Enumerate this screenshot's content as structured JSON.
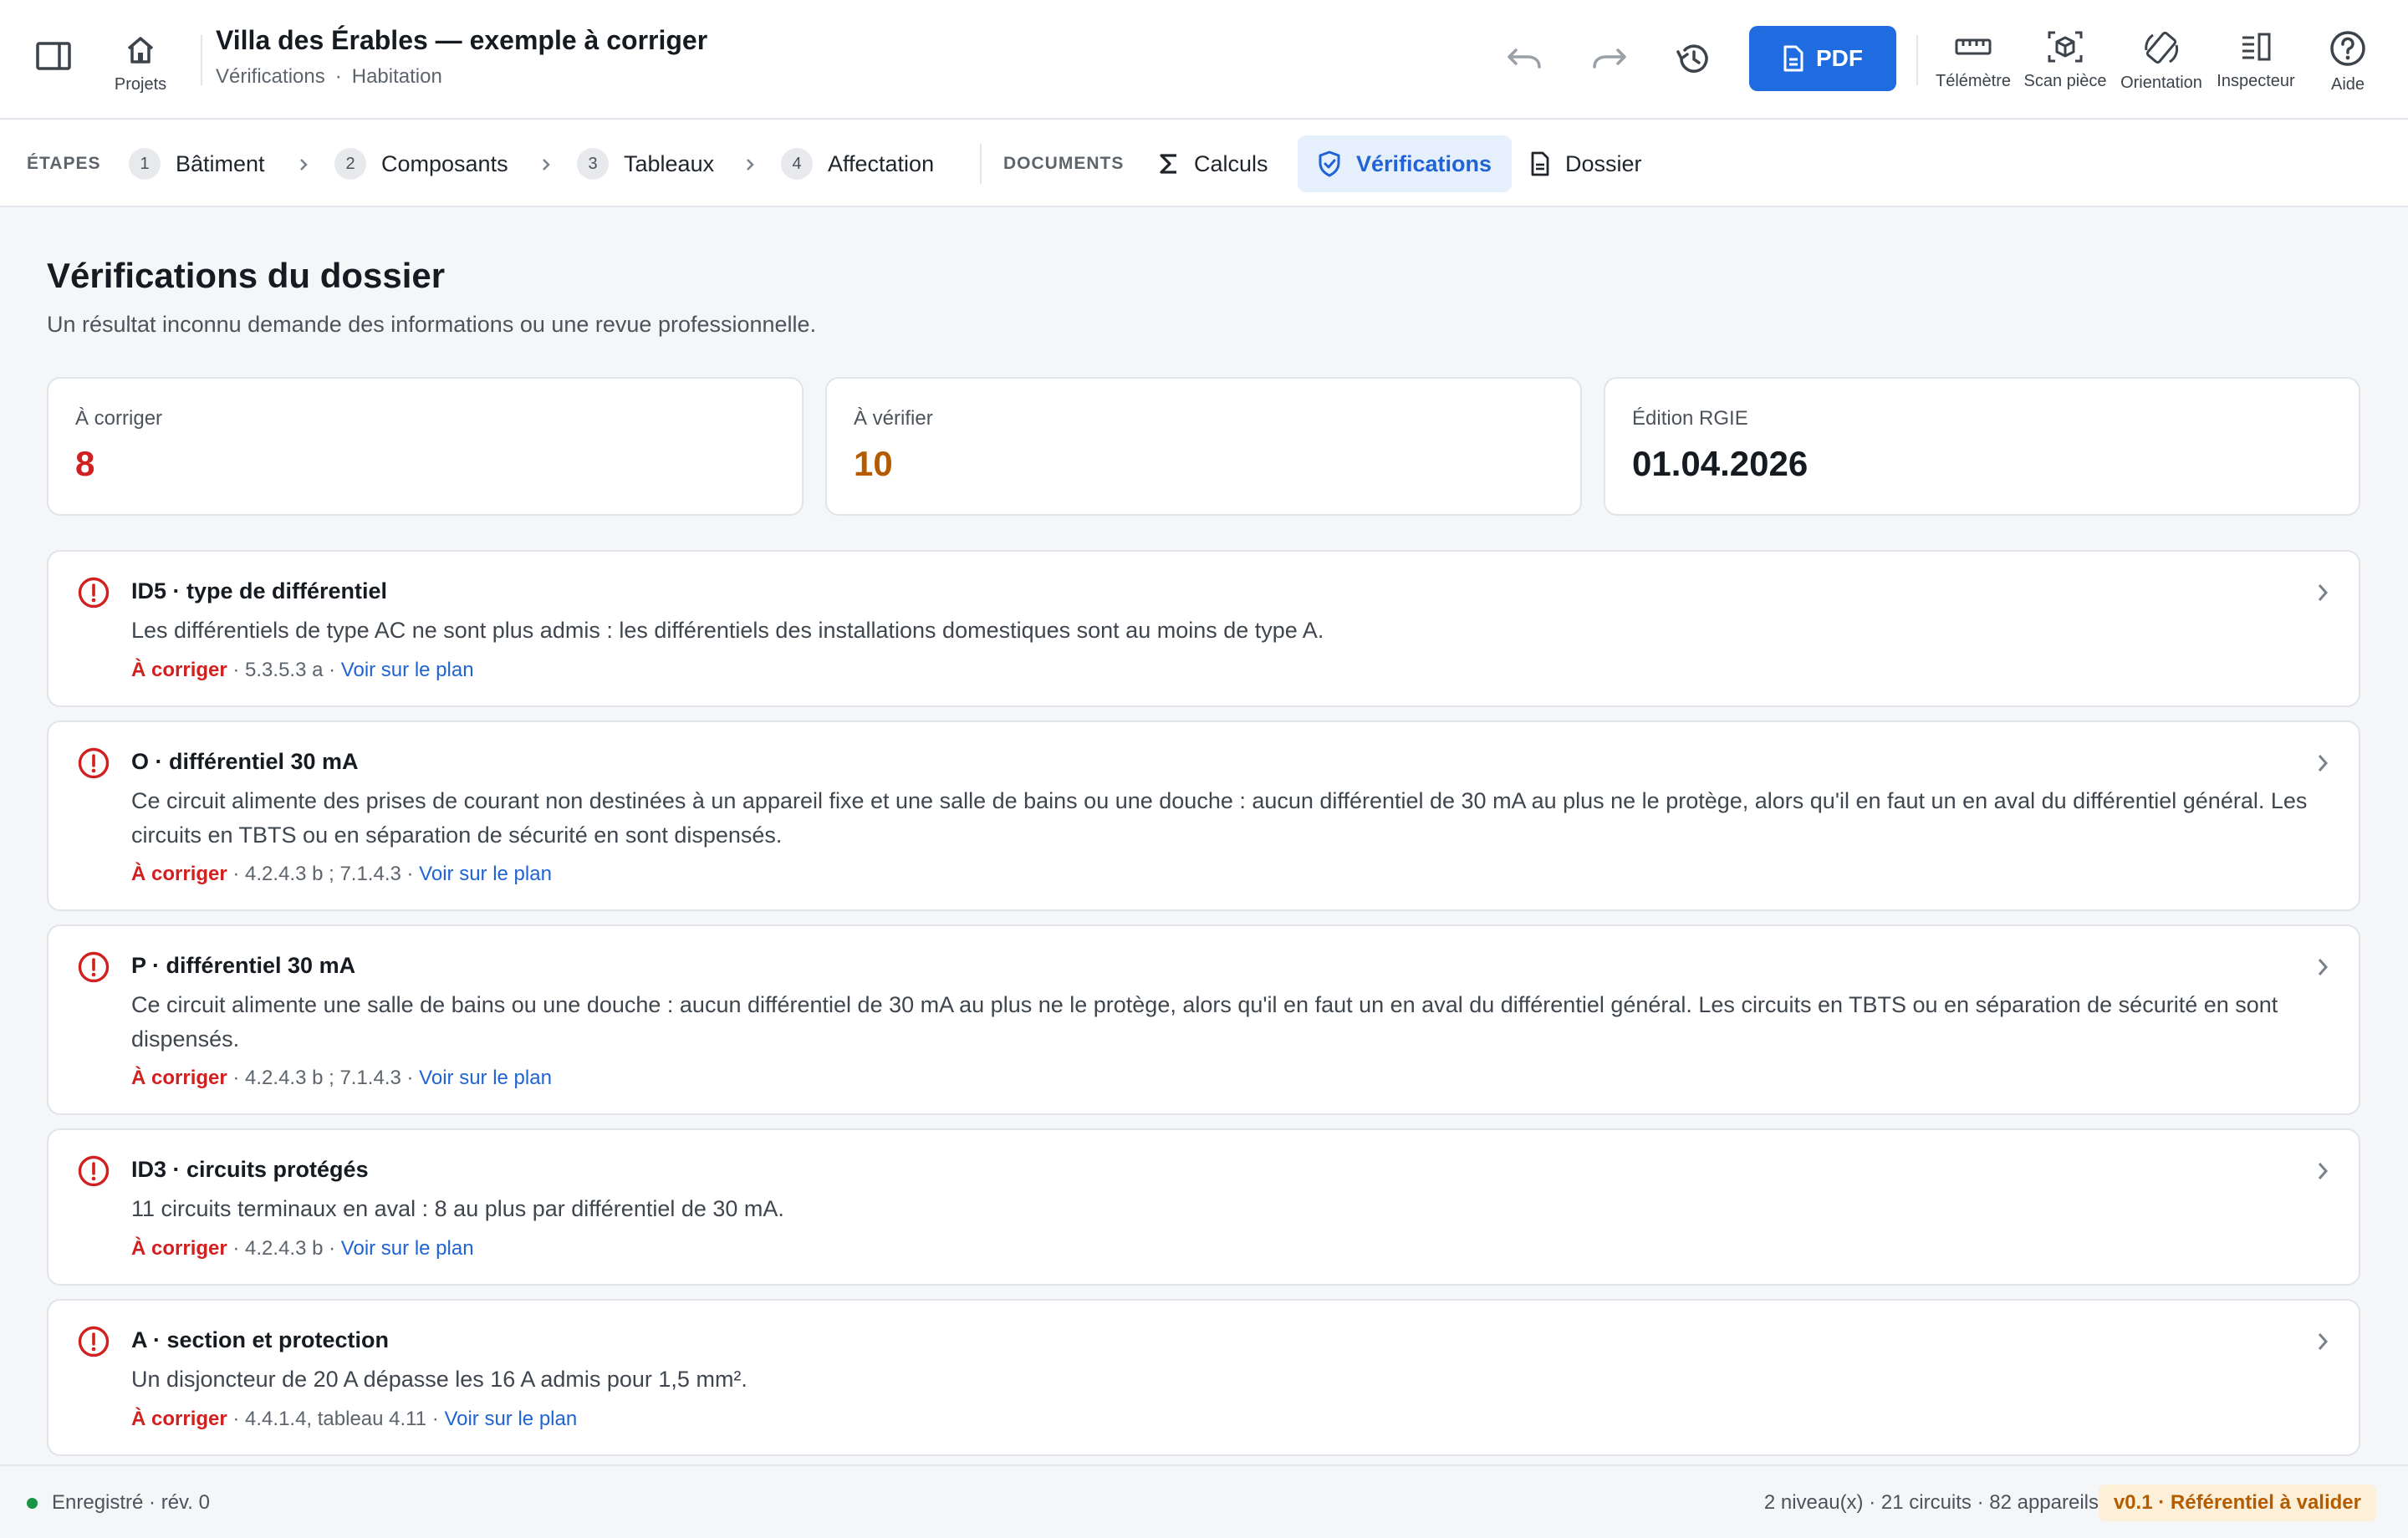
{
  "header": {
    "title": "Villa des Érables — exemple à corriger",
    "sub_section": "Vérifications",
    "sub_type": "Habitation",
    "projects_label": "Projets",
    "pdf_label": "PDF",
    "tools": [
      {
        "label": "Télémètre",
        "icon": "ruler-icon"
      },
      {
        "label": "Scan pièce",
        "icon": "scan-cube-icon"
      },
      {
        "label": "Orientation",
        "icon": "rotate-device-icon"
      },
      {
        "label": "Inspecteur",
        "icon": "inspector-panel-icon"
      },
      {
        "label": "Aide",
        "icon": "help-icon"
      }
    ]
  },
  "steps": {
    "label": "ÉTAPES",
    "items": [
      {
        "num": "1",
        "label": "Bâtiment"
      },
      {
        "num": "2",
        "label": "Composants"
      },
      {
        "num": "3",
        "label": "Tableaux"
      },
      {
        "num": "4",
        "label": "Affectation"
      }
    ]
  },
  "documents": {
    "label": "DOCUMENTS",
    "items": [
      {
        "label": "Calculs",
        "icon": "sigma-icon"
      },
      {
        "label": "Vérifications",
        "icon": "shield-check-icon",
        "active": true
      },
      {
        "label": "Dossier",
        "icon": "document-icon"
      }
    ]
  },
  "page": {
    "title": "Vérifications du dossier",
    "subtitle": "Un résultat inconnu demande des informations ou une revue professionnelle."
  },
  "summary": [
    {
      "label": "À corriger",
      "value": "8",
      "color": "#d12020"
    },
    {
      "label": "À vérifier",
      "value": "10",
      "color": "#b35c00"
    },
    {
      "label": "Édition RGIE",
      "value": "01.04.2026",
      "color": "#161b21"
    }
  ],
  "issues": [
    {
      "title": "ID5 · type de différentiel",
      "desc": "Les différentiels de type AC ne sont plus admis : les différentiels des installations domestiques sont au moins de type A.",
      "status": "À corriger",
      "ref": " · 5.3.5.3 a · ",
      "link": "Voir sur le plan"
    },
    {
      "title": "O · différentiel 30 mA",
      "desc": "Ce circuit alimente des prises de courant non destinées à un appareil fixe et une salle de bains ou une douche : aucun différentiel de 30 mA au plus ne le protège, alors qu'il en faut un en aval du différentiel général. Les circuits en TBTS ou en séparation de sécurité en sont dispensés.",
      "status": "À corriger",
      "ref": " · 4.2.4.3 b ; 7.1.4.3 · ",
      "link": "Voir sur le plan"
    },
    {
      "title": "P · différentiel 30 mA",
      "desc": "Ce circuit alimente une salle de bains ou une douche : aucun différentiel de 30 mA au plus ne le protège, alors qu'il en faut un en aval du différentiel général. Les circuits en TBTS ou en séparation de sécurité en sont dispensés.",
      "status": "À corriger",
      "ref": " · 4.2.4.3 b ; 7.1.4.3 · ",
      "link": "Voir sur le plan"
    },
    {
      "title": "ID3 · circuits protégés",
      "desc": "11 circuits terminaux en aval : 8 au plus par différentiel de 30 mA.",
      "status": "À corriger",
      "ref": " · 4.2.4.3 b · ",
      "link": "Voir sur le plan"
    },
    {
      "title": "A · section et protection",
      "desc": "Un disjoncteur de 20 A dépasse les 16 A admis pour 1,5 mm².",
      "status": "À corriger",
      "ref": " · 4.4.1.4, tableau 4.11 · ",
      "link": "Voir sur le plan"
    }
  ],
  "footer": {
    "saved": "Enregistré · rév. 0",
    "stats": "2 niveau(x) · 21 circuits · 82 appareils",
    "badge": "v0.1 · Référentiel à valider"
  }
}
